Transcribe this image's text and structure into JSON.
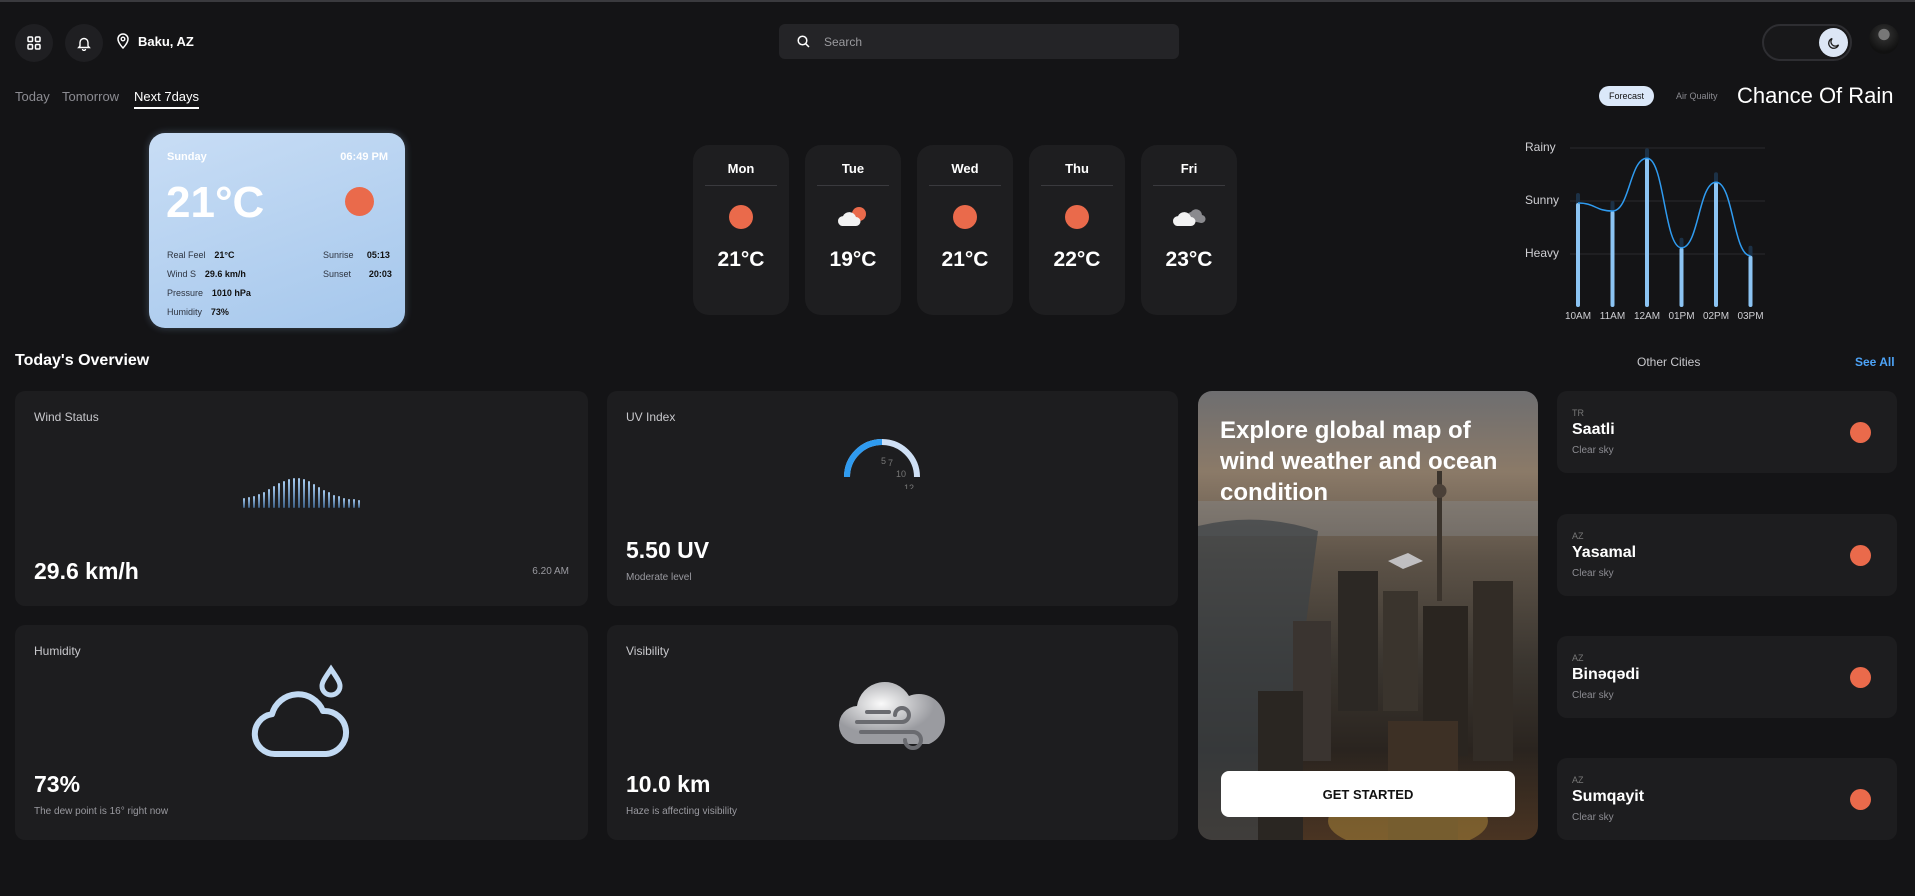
{
  "header": {
    "location": "Baku, AZ",
    "search_placeholder": "Search"
  },
  "tabs": [
    "Today",
    "Tomorrow",
    "Next 7days"
  ],
  "active_tab": "Next 7days",
  "chart_toggle": {
    "forecast": "Forecast",
    "air_quality": "Air Quality",
    "title": "Chance Of Rain"
  },
  "current": {
    "day": "Sunday",
    "time": "06:49 PM",
    "temp": "21°C",
    "real_feel_label": "Real Feel",
    "real_feel": "21°C",
    "wind_label": "Wind S",
    "wind": "29.6 km/h",
    "pressure_label": "Pressure",
    "pressure": "1010 hPa",
    "humidity_label": "Humidity",
    "humidity": "73%",
    "sunrise_label": "Sunrise",
    "sunrise": "05:13",
    "sunset_label": "Sunset",
    "sunset": "20:03"
  },
  "forecast": [
    {
      "day": "Mon",
      "temp": "21°C",
      "icon": "sun-icon"
    },
    {
      "day": "Tue",
      "temp": "19°C",
      "icon": "partly-cloudy-icon"
    },
    {
      "day": "Wed",
      "temp": "21°C",
      "icon": "sun-icon"
    },
    {
      "day": "Thu",
      "temp": "22°C",
      "icon": "sun-icon"
    },
    {
      "day": "Fri",
      "temp": "23°C",
      "icon": "cloudy-icon"
    }
  ],
  "chart_data": {
    "type": "bar",
    "title": "Chance Of Rain",
    "categories": [
      "10AM",
      "11AM",
      "12AM",
      "01PM",
      "02PM",
      "03PM"
    ],
    "y_levels": [
      "Rainy",
      "Sunny",
      "Heavy"
    ],
    "values": [
      0.65,
      0.6,
      0.93,
      0.37,
      0.78,
      0.32
    ]
  },
  "overview": {
    "title": "Today's Overview",
    "other_cities": "Other Cities",
    "see_all": "See All"
  },
  "wind": {
    "title": "Wind Status",
    "value": "29.6 km/h",
    "time": "6.20 AM"
  },
  "uv": {
    "title": "UV Index",
    "value": "5.50 UV",
    "level": "Moderate level",
    "ticks": [
      "5",
      "7",
      "10",
      "12"
    ]
  },
  "humidity": {
    "title": "Humidity",
    "value": "73%",
    "note": "The dew point is 16° right now"
  },
  "visibility": {
    "title": "Visibility",
    "value": "10.0 km",
    "note": "Haze is affecting visibility"
  },
  "promo": {
    "text": "Explore global map of wind weather and ocean condition",
    "button": "GET STARTED"
  },
  "cities": [
    {
      "country": "TR",
      "name": "Saatli",
      "desc": "Clear sky"
    },
    {
      "country": "AZ",
      "name": "Yasamal",
      "desc": "Clear sky"
    },
    {
      "country": "AZ",
      "name": "Binəqədi",
      "desc": "Clear sky"
    },
    {
      "country": "AZ",
      "name": "Sumqayit",
      "desc": "Clear sky"
    }
  ],
  "colors": {
    "background": "#141416",
    "card": "#1d1d1f",
    "accent": "#2f9bf0",
    "sun": "#ea6a4b"
  }
}
